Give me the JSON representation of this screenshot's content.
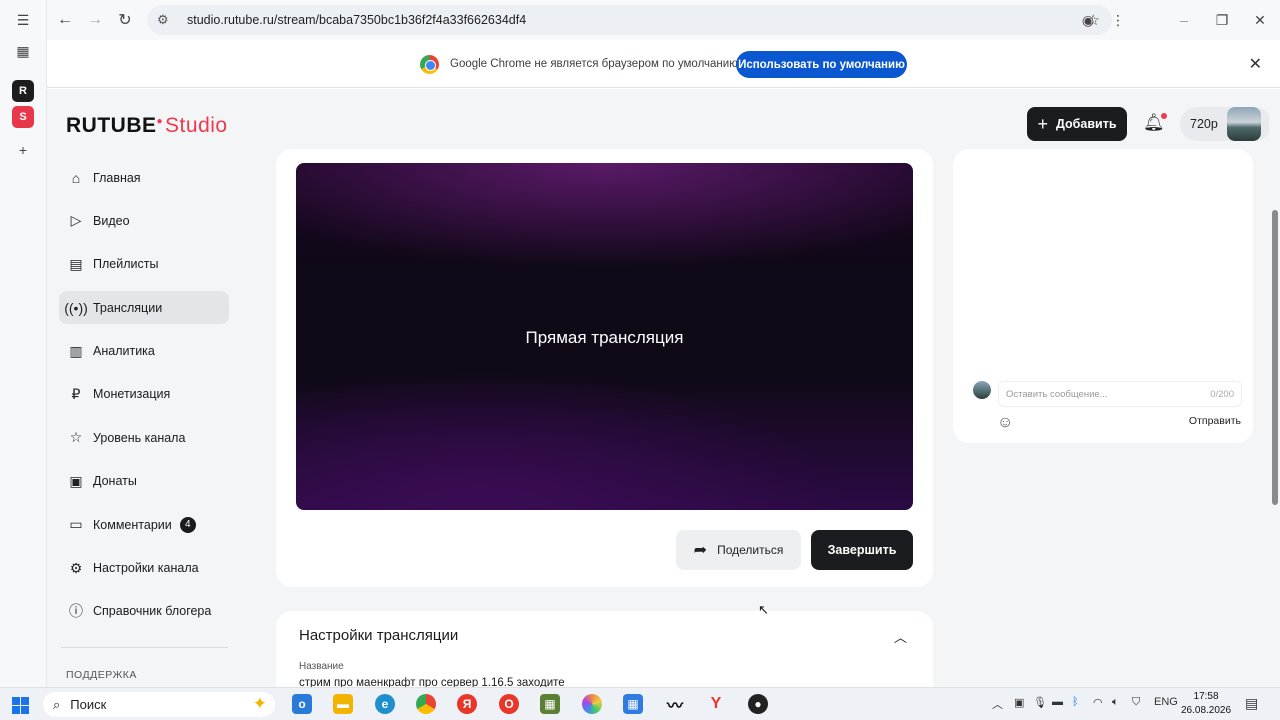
{
  "browser": {
    "url": "studio.rutube.ru/stream/bcaba7350bc1b36f2f4a33f662634df4",
    "infobar_message": "Google Chrome не является браузером по умолчанию.",
    "infobar_button": "Использовать по умолчанию"
  },
  "header": {
    "logo_main": "RUTUBE",
    "logo_studio": "Studio",
    "add_button": "Добавить",
    "resolution": "720p"
  },
  "nav": {
    "items": [
      {
        "label": "Главная",
        "icon": "home-icon"
      },
      {
        "label": "Видео",
        "icon": "video-icon"
      },
      {
        "label": "Плейлисты",
        "icon": "playlist-icon"
      },
      {
        "label": "Трансляции",
        "icon": "broadcast-icon",
        "active": true
      },
      {
        "label": "Аналитика",
        "icon": "analytics-icon"
      },
      {
        "label": "Монетизация",
        "icon": "ruble-icon"
      },
      {
        "label": "Уровень канала",
        "icon": "star-icon"
      },
      {
        "label": "Донаты",
        "icon": "wallet-icon"
      },
      {
        "label": "Комментарии",
        "icon": "comment-icon",
        "badge": "4"
      },
      {
        "label": "Настройки канала",
        "icon": "gear-icon"
      },
      {
        "label": "Справочник блогера",
        "icon": "info-icon"
      }
    ],
    "support_label": "ПОДДЕРЖКА"
  },
  "player": {
    "label": "Прямая трансляция"
  },
  "actions": {
    "share": "Поделиться",
    "finish": "Завершить"
  },
  "settings": {
    "title": "Настройки трансляции",
    "field_label": "Название",
    "field_value": "стрим про маенкрафт про сервер 1.16.5 заходите"
  },
  "chat": {
    "placeholder": "Оставить сообщение...",
    "counter": "0/200",
    "send": "Отправить"
  },
  "taskbar": {
    "search": "Поиск",
    "lang": "ENG",
    "time": "17:58",
    "date": "26.08.2026"
  },
  "colors": {
    "accent": "#ee3a4e",
    "dark_button": "#1b1c1f",
    "chrome_blue": "#0b57d0"
  }
}
